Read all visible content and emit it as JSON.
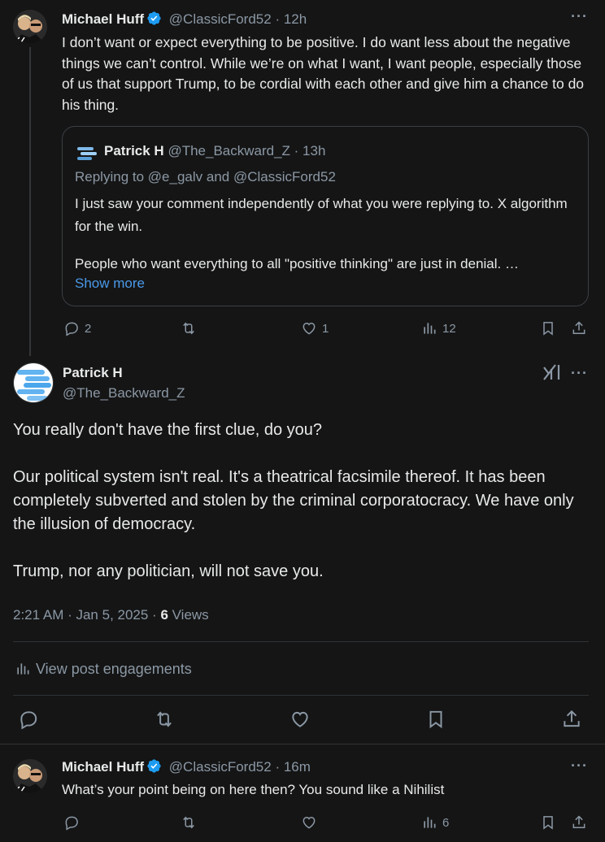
{
  "post1": {
    "author_name": "Michael Huff",
    "author_handle": "@ClassicFord52",
    "time": "12h",
    "text": "I don’t want or expect everything to be positive. I do want less about the negative things we can’t control.  While we’re on what I want, I want people, especially those of us that support Trump, to be cordial with each other and give him a chance to do his thing.",
    "quote": {
      "author_name": "Patrick H",
      "author_handle": "@The_Backward_Z",
      "time": "13h",
      "replying_to_prefix": "Replying to",
      "replying_to_1": "@e_galv",
      "replying_to_and": "and",
      "replying_to_2": "@ClassicFord52",
      "line1": "I just saw your comment independently of what you were replying to. X algorithm for the win.",
      "line2": "People who want everything to all \"positive thinking\" are just in denial. …",
      "show_more": "Show more"
    },
    "replies": "2",
    "likes": "1",
    "views": "12"
  },
  "main_post": {
    "author_name": "Patrick H",
    "author_handle": "@The_Backward_Z",
    "para1": "You really don't have the first clue, do you?",
    "para2": "Our political system isn't real. It's a theatrical facsimile thereof. It has been completely subverted and stolen by the criminal corporatocracy. We have only the illusion of democracy.",
    "para3": "Trump, nor any politician, will not save you.",
    "timestamp": "2:21 AM · Jan 5, 2025 · ",
    "views_count": "6",
    "views_label": " Views",
    "engagements": "View post engagements"
  },
  "reply": {
    "author_name": "Michael Huff",
    "author_handle": "@ClassicFord52",
    "time": "16m",
    "text": "What’s your point being on here then? You sound like a Nihilist",
    "views": "6"
  },
  "colors": {
    "background": "#151515",
    "verified": "#1d9bf0",
    "link": "#4a99e9",
    "muted": "#8b98a5"
  }
}
